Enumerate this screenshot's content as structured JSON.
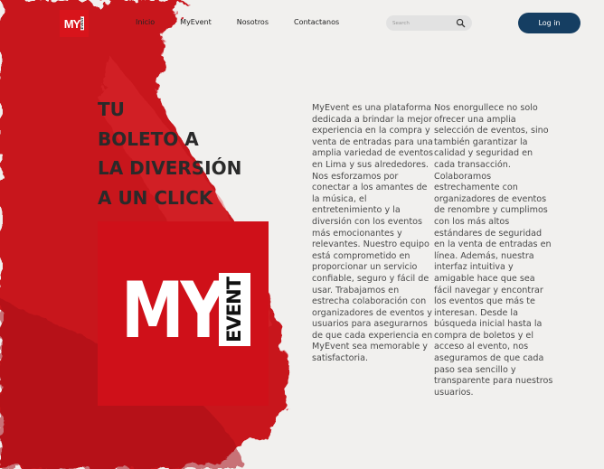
{
  "nav": {
    "logo_text": "MY",
    "logo_sub": "EVENT",
    "links": [
      "Inicio",
      "MyEvent",
      "Nosotros",
      "Contactanos"
    ],
    "search_placeholder": "Search",
    "login_label": "Log in"
  },
  "hero": {
    "headline": [
      "TU",
      "BOLETO A",
      "LA DIVERSIÓN",
      "A UN CLICK"
    ],
    "logo_text": "MY",
    "logo_sub": "EVENT"
  },
  "content": {
    "col1": "MyEvent es una plataforma dedicada a brindar la mejor experiencia en la compra y venta de entradas para una amplia variedad de eventos en Lima y sus alrededores. Nos esforzamos por conectar a los amantes de la música, el entretenimiento y la diversión con los eventos más emocionantes y relevantes. Nuestro equipo está comprometido en proporcionar un servicio confiable, seguro y fácil de usar. Trabajamos en estrecha colaboración con organizadores de eventos y usuarios para asegurarnos de que cada experiencia en MyEvent sea memorable y satisfactoria.",
    "col2": "Nos enorgullece no solo ofrecer una amplia selección de eventos, sino también garantizar la calidad y seguridad en cada transacción. Colaboramos estrechamente con organizadores de eventos de renombre y cumplimos con los más altos estándares de seguridad en la venta de entradas en línea. Además, nuestra interfaz intuitiva y amigable hace que sea fácil navegar y encontrar los eventos que más te interesan. Desde la búsqueda inicial hasta la compra de boletos y el acceso al evento, nos aseguramos de que cada paso sea sencillo y transparente para nuestros usuarios."
  },
  "colors": {
    "brand_red": "#d8141b",
    "login_bg": "#153e62",
    "paper": "#f1f0ee"
  }
}
